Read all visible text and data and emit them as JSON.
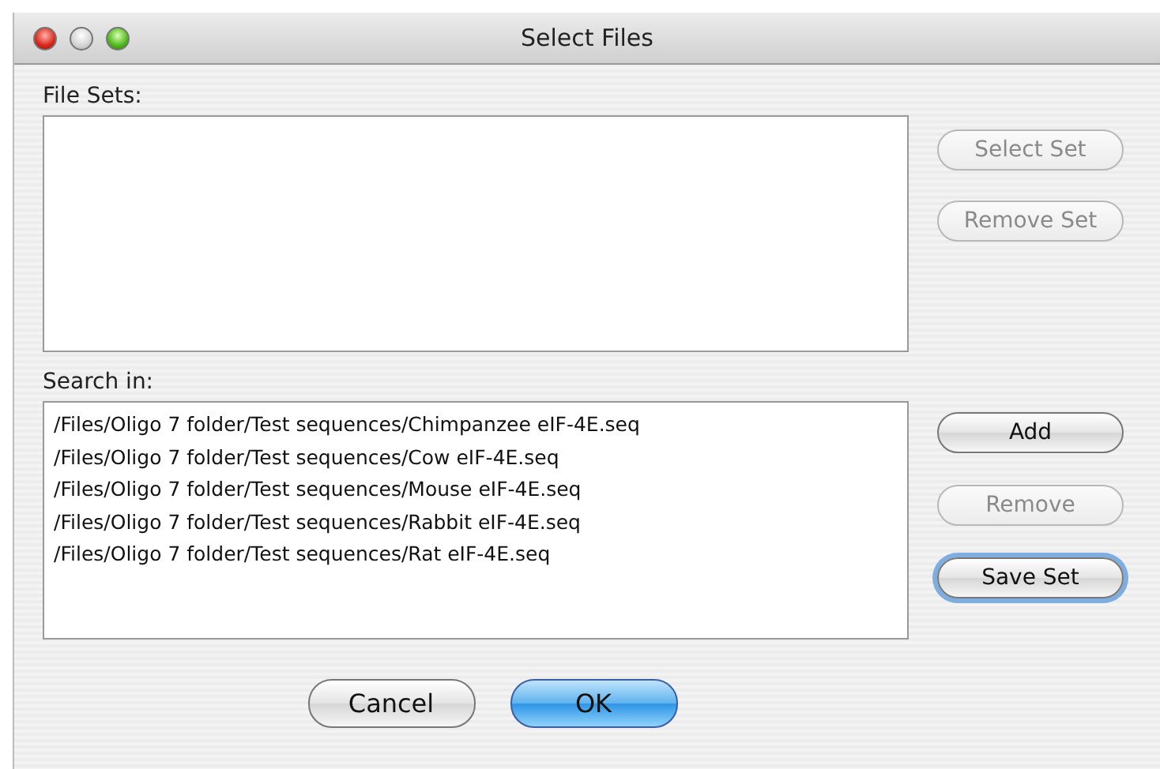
{
  "window": {
    "title": "Select Files"
  },
  "file_sets": {
    "label": "File Sets:"
  },
  "file_set_buttons": [
    {
      "label": "Select Set",
      "disabled": true,
      "focused": false,
      "default": false
    },
    {
      "label": "Remove Set",
      "disabled": true,
      "focused": false,
      "default": false
    }
  ],
  "search_in": {
    "label": "Search in:",
    "items": [
      {
        "path": "/Files/Oligo 7 folder/Test sequences/Chimpanzee eIF-4E.seq",
        "selected": false
      },
      {
        "path": "/Files/Oligo 7 folder/Test sequences/Cow eIF-4E.seq",
        "selected": false
      },
      {
        "path": "/Files/Oligo 7 folder/Test sequences/Mouse eIF-4E.seq",
        "selected": false
      },
      {
        "path": "/Files/Oligo 7 folder/Test sequences/Rabbit eIF-4E.seq",
        "selected": false
      },
      {
        "path": "/Files/Oligo 7 folder/Test sequences/Rat eIF-4E.seq",
        "selected": false
      }
    ]
  },
  "search_buttons": [
    {
      "label": "Add",
      "disabled": false,
      "focused": false,
      "default": false
    },
    {
      "label": "Remove",
      "disabled": true,
      "focused": false,
      "default": false
    },
    {
      "label": "Save Set",
      "disabled": false,
      "focused": true,
      "default": false
    }
  ],
  "dialog_buttons": [
    {
      "label": "Cancel",
      "disabled": false,
      "focused": false,
      "default": false
    },
    {
      "label": "OK",
      "disabled": false,
      "focused": false,
      "default": true
    }
  ]
}
